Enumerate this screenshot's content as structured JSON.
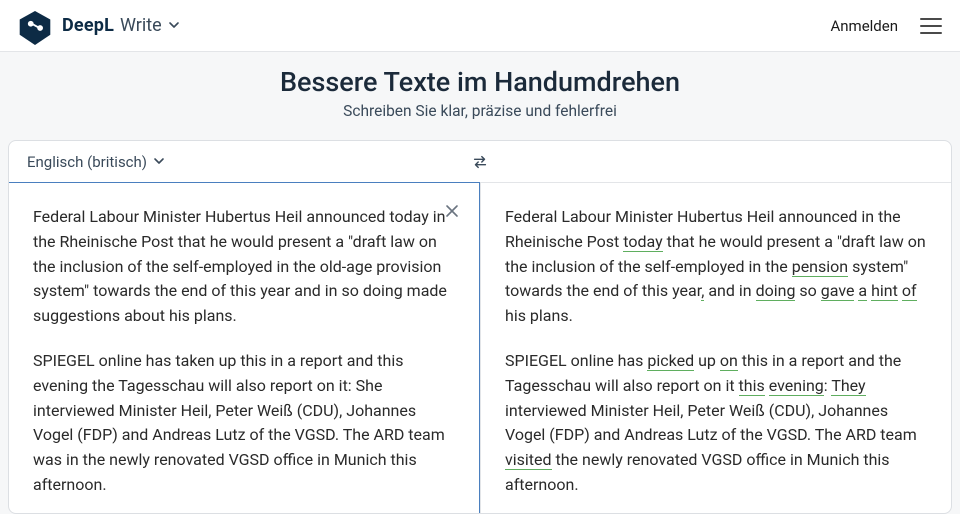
{
  "header": {
    "brand": "DeepL",
    "product": "Write",
    "login": "Anmelden"
  },
  "hero": {
    "title": "Bessere Texte im Handumdrehen",
    "subtitle": "Schreiben Sie klar, präzise und fehlerfrei"
  },
  "toolbar": {
    "language": "Englisch (britisch)"
  },
  "input": {
    "p1": "Federal Labour Minister Hubertus Heil announced today in the Rheinische Post that he would present a \"draft law on the inclusion of the self-employed in the old-age provision system\" towards the end of this year and in so doing made suggestions about his plans.",
    "p2": "SPIEGEL online has taken up this in a report and this evening the Tagesschau will also report on it: She interviewed Minister Heil, Peter Weiß (CDU), Johannes Vogel (FDP) and Andreas Lutz of the VGSD. The ARD team was in the newly renovated VGSD office in Munich this afternoon."
  },
  "output": {
    "p1": {
      "s0": "Federal Labour Minister Hubertus Heil announced in the Rheinische Post ",
      "w1": "today",
      "s1": " that he would present a \"draft law on the inclusion of the self-employed in the ",
      "w2": "pension",
      "s2": " system\" towards the end of this year",
      "w3": ",",
      "s3": " and in ",
      "w4": "doing",
      "s4": " so ",
      "w5": "gave",
      "s5": " ",
      "w6": "a",
      "s6": " ",
      "w7": "hint",
      "s7": " ",
      "w8": "of",
      "s8": " his plans."
    },
    "p2": {
      "s0": "SPIEGEL online has ",
      "w1": "picked",
      "s1": " up ",
      "w2": "on",
      "s2": " this in a report and the Tagesschau will also report on it ",
      "w3": "this",
      "s3": " ",
      "w4": "evening",
      "s4": ": ",
      "w5": "They",
      "s5": " interviewed Minister Heil, Peter Weiß (CDU), Johannes Vogel (FDP) and Andreas Lutz of the VGSD. The ARD team ",
      "w6": "visited",
      "s6": " the newly renovated VGSD office in Munich this afternoon."
    }
  }
}
